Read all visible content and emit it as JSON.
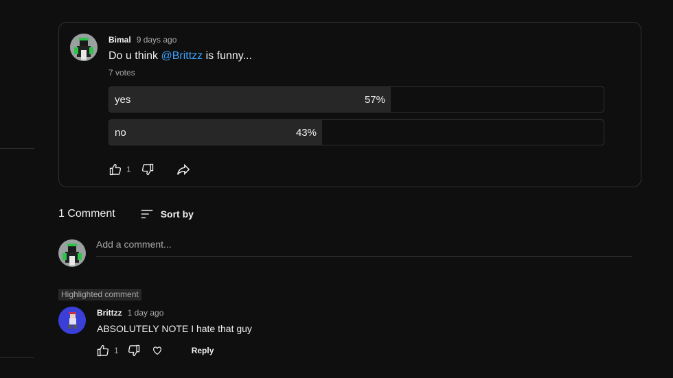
{
  "post": {
    "author": "Bimal",
    "time": "9 days ago",
    "text_prefix": "Do u think ",
    "mention": "@Brittzz",
    "text_suffix": " is funny...",
    "votes": "7 votes",
    "options": [
      {
        "label": "yes",
        "percent_label": "57%",
        "fraction": 0.57
      },
      {
        "label": "no",
        "percent_label": "43%",
        "fraction": 0.43
      }
    ],
    "like_count": "1"
  },
  "comments": {
    "count_label": "1 Comment",
    "sort_label": "Sort by",
    "add_placeholder": "Add a comment...",
    "highlight_label": "Highlighted comment",
    "items": [
      {
        "author": "Brittzz",
        "time": "1 day ago",
        "text": "ABSOLUTELY NOTE I hate that guy",
        "like_count": "1",
        "reply_label": "Reply"
      }
    ]
  },
  "colors": {
    "accent": "#3ea6ff",
    "bg": "#0f0f0f",
    "poll_fill": "#272727",
    "avatar2_bg": "#3a3fd8"
  },
  "icons": [
    "thumbs-up-icon",
    "thumbs-down-icon",
    "share-icon",
    "sort-icon",
    "heart-icon"
  ]
}
